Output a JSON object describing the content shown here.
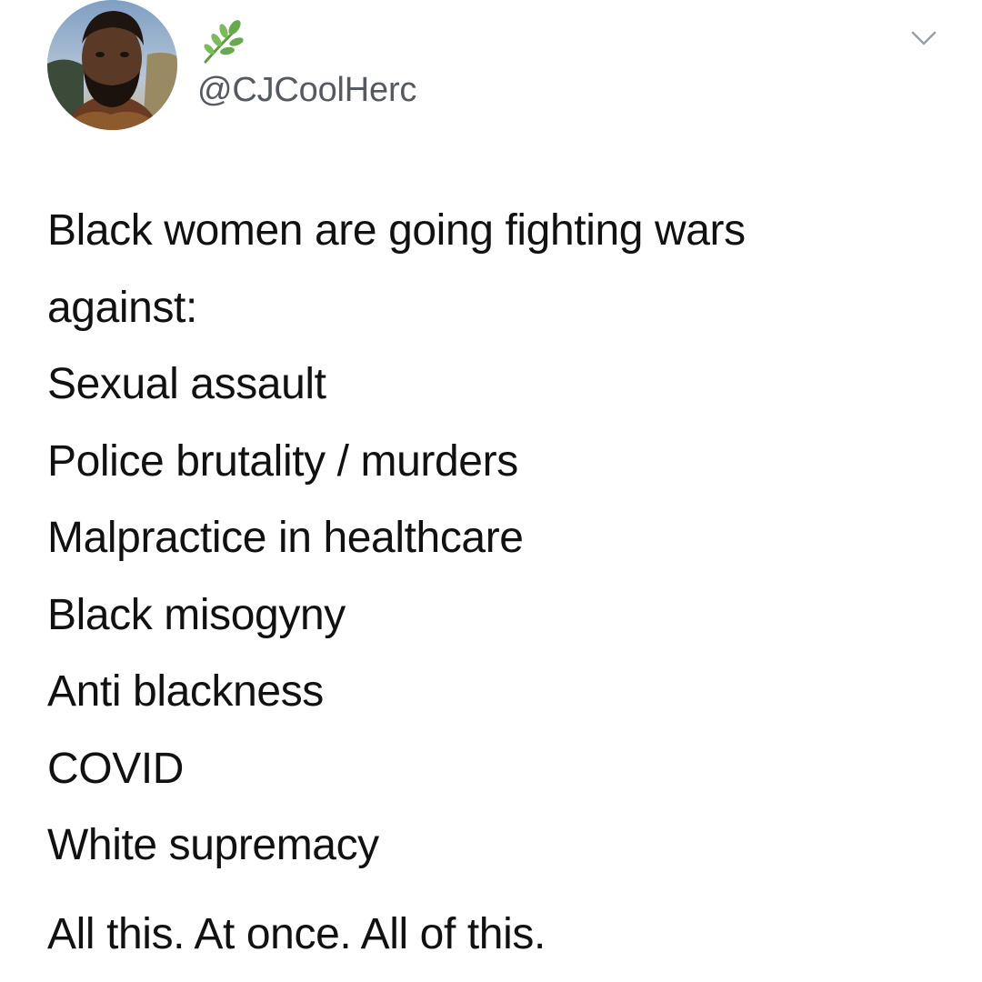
{
  "tweet": {
    "handle": "@CJCoolHerc",
    "icons": {
      "avatar": "profile-photo",
      "badge": "leaf-sprig-icon",
      "menu": "chevron-down-icon"
    },
    "lines": [
      "Black women are going fighting wars",
      "against:",
      "Sexual assault",
      "Police brutality / murders",
      "Malpractice in healthcare",
      "Black misogyny",
      "Anti blackness",
      "COVID",
      "White supremacy"
    ],
    "closing": "All this. At once. All of this."
  },
  "colors": {
    "background": "#ffffff",
    "text": "#111111",
    "handle": "#555a60",
    "leaf": "#6aa84f",
    "caret": "#9aa0a6"
  }
}
